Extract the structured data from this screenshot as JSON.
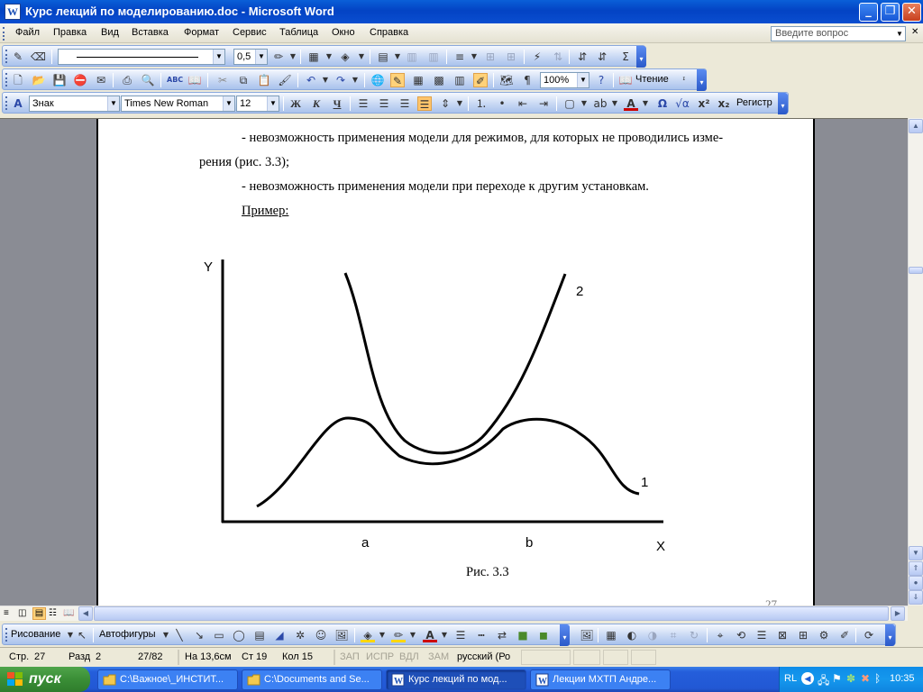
{
  "window": {
    "title": "Курс лекций по моделированию.doc - Microsoft Word",
    "app_icon_glyph": "W",
    "minimize_glyph": "_",
    "maximize_glyph": "❐",
    "close_glyph": "✕"
  },
  "menu": {
    "items": [
      "Файл",
      "Правка",
      "Вид",
      "Вставка",
      "Формат",
      "Сервис",
      "Таблица",
      "Окно",
      "Справка"
    ],
    "help_placeholder": "Введите вопрос"
  },
  "toolbar_lines": {
    "line_weight": "0,5"
  },
  "toolbar_standard": {
    "zoom": "100%",
    "reading_label": "Чтение"
  },
  "toolbar_format": {
    "style": "Знак",
    "font": "Times New Roman",
    "size": "12",
    "bold": "Ж",
    "italic": "К",
    "underline": "Ч",
    "omega": "Ω",
    "sup": "x²",
    "sub": "x₂",
    "case_label": "Регистр"
  },
  "document": {
    "line1": "- невозможность применения модели для режимов, для которых не проводились изме-",
    "line2": "рения (рис. 3.3);",
    "line3": "- невозможность применения модели при переходе к другим установкам.",
    "example": "Пример:",
    "figure": {
      "y_label": "Y",
      "x_label": "X",
      "curve1_label": "1",
      "curve2_label": "2",
      "a_label": "a",
      "b_label": "b",
      "caption": "Рис. 3.3"
    },
    "page_number_partial": "27"
  },
  "drawing_toolbar": {
    "draw_label": "Рисование",
    "autoshapes_label": "Автофигуры"
  },
  "status": {
    "page": "Стр.",
    "page_num": "27",
    "section": "Разд",
    "section_num": "2",
    "pages": "27/82",
    "at": "На 13,6см",
    "line": "Ст 19",
    "col": "Кол 15",
    "rec": "ЗАП",
    "trk": "ИСПР",
    "ext": "ВДЛ",
    "ovr": "ЗАМ",
    "lang": "русский (Ро"
  },
  "taskbar": {
    "start": "пуск",
    "tasks": [
      "C:\\Важное\\_ИНСТИТ...",
      "C:\\Documents and Se...",
      "Курс лекций по мод...",
      "Лекции МХТП Андре..."
    ],
    "lang": "RL",
    "clock": "10:35"
  },
  "colors": {
    "title_bar": "#0a5fd8",
    "page_bg": "#ffffff",
    "desk_bg": "#8a8c94",
    "taskbar": "#245edb",
    "start": "#3a8e36",
    "tray": "#1598ed"
  }
}
